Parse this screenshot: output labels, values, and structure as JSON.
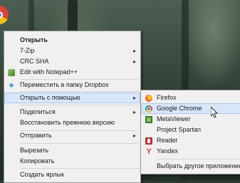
{
  "context_menu": {
    "items": [
      {
        "label": "Открыть",
        "bold": true
      },
      {
        "label": "7-Zip",
        "submenu": true
      },
      {
        "label": "CRC SHA",
        "submenu": true
      },
      {
        "label": "Edit with Notepad++",
        "icon": "notepad-plus-plus-icon"
      },
      {
        "label": "Переместить в папку Dropbox",
        "icon": "dropbox-icon"
      },
      {
        "label": "Открыть с помощью",
        "submenu": true,
        "highlighted": true
      },
      {
        "label": "Поделиться",
        "submenu": true
      },
      {
        "label": "Восстановить прежнюю версию"
      },
      {
        "label": "Отправить",
        "submenu": true
      },
      {
        "label": "Вырезать"
      },
      {
        "label": "Копировать"
      },
      {
        "label": "Создать ярлык"
      }
    ]
  },
  "open_with_submenu": {
    "items": [
      {
        "label": "Firefox",
        "icon": "firefox-icon"
      },
      {
        "label": "Google Chrome",
        "icon": "chrome-icon",
        "highlighted": true
      },
      {
        "label": "MetaViewer",
        "icon": "metaviewer-icon"
      },
      {
        "label": "Project Spartan"
      },
      {
        "label": "Reader",
        "icon": "reader-icon"
      },
      {
        "label": "Yandex",
        "icon": "yandex-icon"
      },
      {
        "label": "Выбрать другое приложение"
      }
    ]
  },
  "colors": {
    "menu_bg": "#f0f0f0",
    "highlight": "#d7e6f8",
    "highlight_border": "#a6c8f0"
  }
}
